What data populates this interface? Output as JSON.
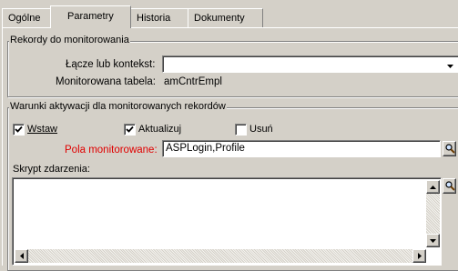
{
  "tabs": [
    {
      "label": "Ogólne"
    },
    {
      "label": "Parametry"
    },
    {
      "label": "Historia"
    },
    {
      "label": "Dokumenty"
    }
  ],
  "active_tab": "Parametry",
  "records_group": {
    "title": "Rekordy do monitorowania",
    "link_label": "Łącze lub kontekst:",
    "link_value": "",
    "table_label": "Monitorowana tabela:",
    "table_value": "amCntrEmpl"
  },
  "conditions_group": {
    "title": "Warunki aktywacji dla monitorowanych rekordów",
    "checkboxes": [
      {
        "label": "Wstaw",
        "checked": true
      },
      {
        "label": "Aktualizuj",
        "checked": true
      },
      {
        "label": "Usuń",
        "checked": false
      }
    ],
    "fields_label": "Pola monitorowane:",
    "fields_value": "ASPLogin,Profile",
    "script_label": "Skrypt zdarzenia:",
    "script_value": ""
  },
  "icons": [
    "dropdown-arrow-icon",
    "magnifier-icon",
    "scroll-up-icon",
    "scroll-down-icon",
    "scroll-left-icon",
    "scroll-right-icon"
  ],
  "colors": {
    "required_label": "#e00000",
    "background": "#d4d0c8"
  }
}
